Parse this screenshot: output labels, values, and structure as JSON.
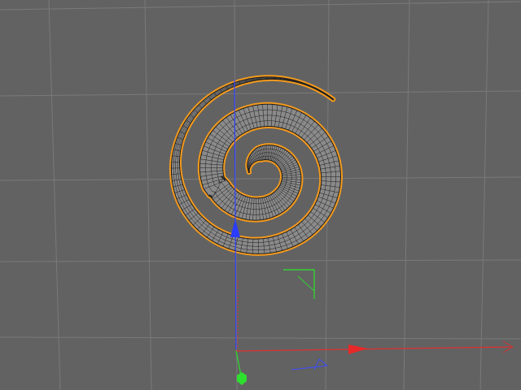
{
  "viewport": {
    "background_color": "#626262",
    "grid_color": "#7a7a7a",
    "selection_highlight_color": "#f39a1e",
    "mesh_fill_color": "#8a8a8a",
    "mesh_wire_color": "#1c1c1c"
  },
  "object": {
    "type": "spiral tube mesh",
    "selected": true
  },
  "gizmo": {
    "x_axis_color": "#e03030",
    "y_axis_color": "#30d030",
    "z_axis_color": "#3040ff",
    "icons": [
      "x-axis-arrow-icon",
      "y-axis-handle-icon",
      "z-axis-arrow-icon",
      "plane-handle-icon"
    ]
  }
}
